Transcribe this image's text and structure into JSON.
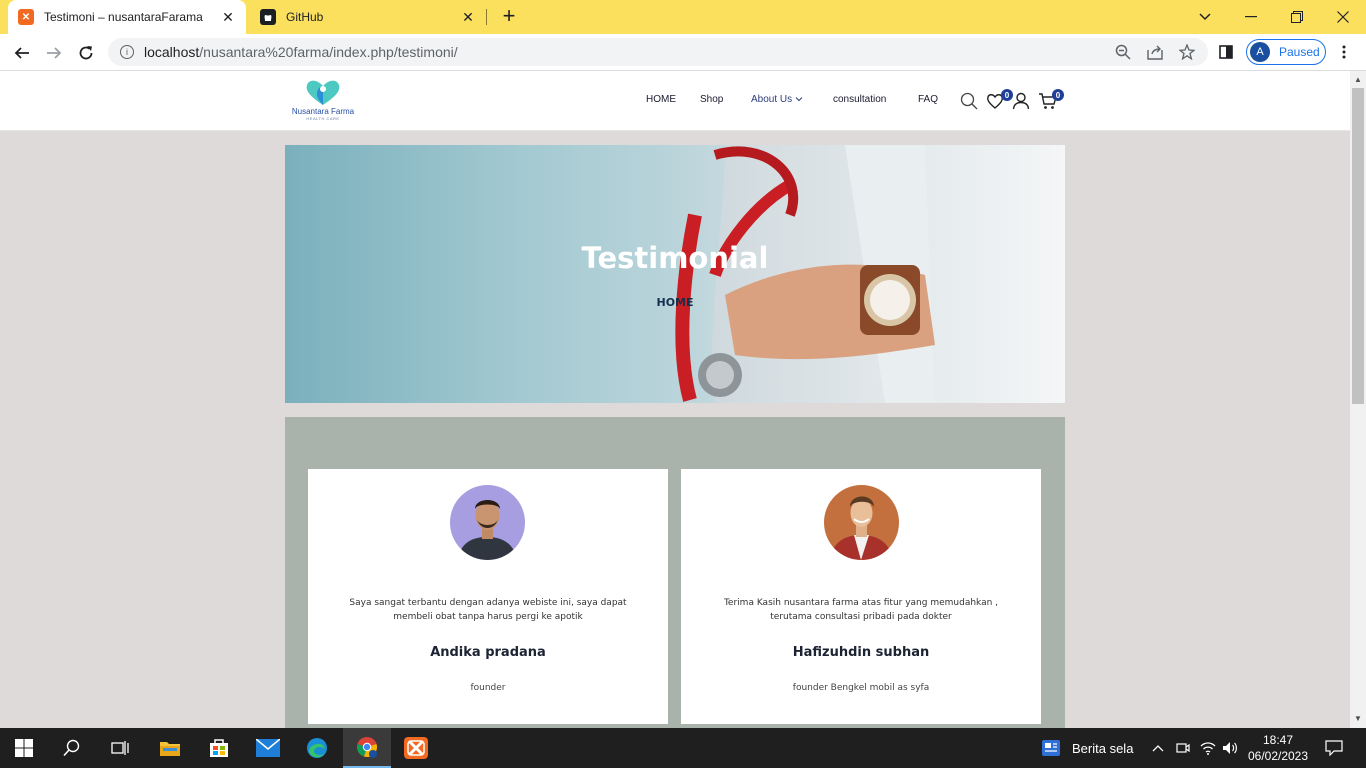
{
  "browser": {
    "tabs": [
      {
        "title": "Testimoni – nusantaraFarama",
        "favicon": "xampp-icon",
        "active": true
      },
      {
        "title": "GitHub",
        "favicon": "github-icon",
        "active": false
      }
    ],
    "url": {
      "host": "localhost",
      "path": "/nusantara%20farma/index.php/testimoni/"
    },
    "profile": {
      "initial": "A",
      "status": "Paused"
    }
  },
  "site": {
    "logo": {
      "name": "Nusantara Farma",
      "tagline": "HEALTH CARE"
    },
    "menu": {
      "home": "HOME",
      "shop": "Shop",
      "about": "About Us",
      "consultation": "consultation",
      "faq": "FAQ"
    },
    "wishlist_count": "0",
    "cart_count": "0",
    "hero": {
      "title": "Testimonial",
      "breadcrumb": "HOME"
    },
    "testimonials": [
      {
        "quote": "Saya sangat terbantu dengan adanya webiste ini, saya dapat membeli obat tanpa harus pergi ke apotik",
        "name": "Andika pradana",
        "role": "founder"
      },
      {
        "quote": "Terima Kasih nusantara farma atas fitur yang memudahkan , terutama consultasi pribadi pada dokter",
        "name": "Hafizuhdin subhan",
        "role": "founder Bengkel mobil as syfa"
      }
    ]
  },
  "taskbar": {
    "news": "Berita sela",
    "time": "18:47",
    "date": "06/02/2023"
  },
  "colors": {
    "tabstrip": "#fbe05e",
    "brand_navy": "#1f3f99",
    "section_bg": "#aab3ab",
    "page_bg": "#dedad9"
  }
}
